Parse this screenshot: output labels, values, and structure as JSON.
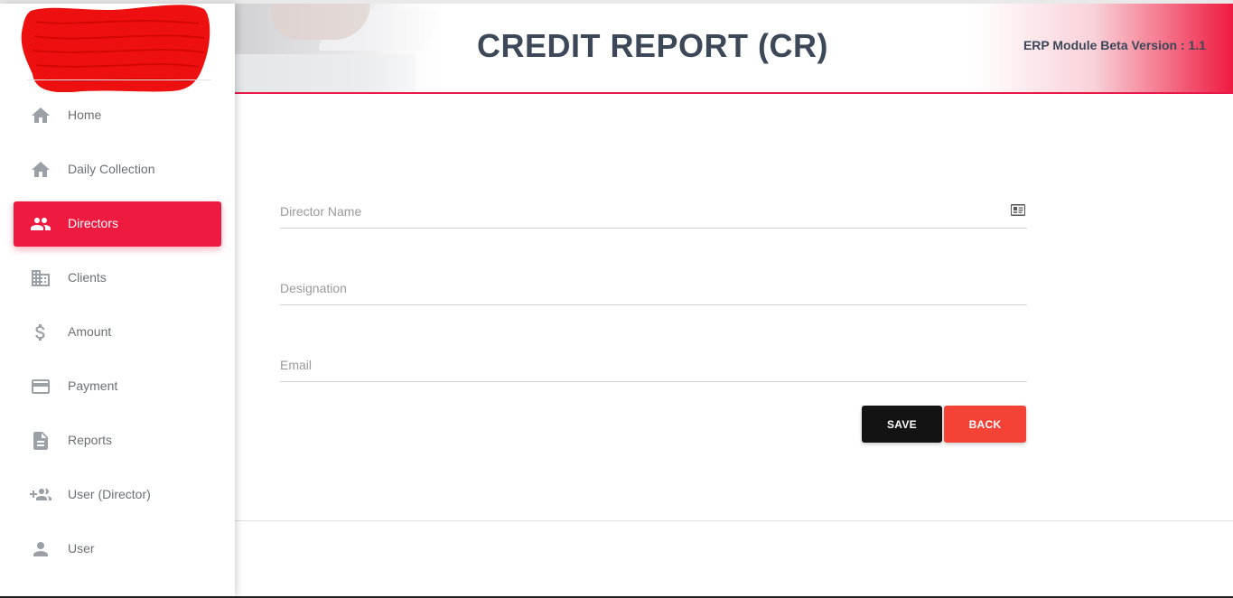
{
  "header": {
    "title": "CREDIT REPORT (CR)",
    "version": "ERP Module Beta Version : 1.1"
  },
  "sidebar": {
    "logo_icon": "redacted-logo",
    "items": [
      {
        "label": "Home",
        "icon": "home-icon",
        "active": false
      },
      {
        "label": "Daily Collection",
        "icon": "home-icon",
        "active": false
      },
      {
        "label": "Directors",
        "icon": "people-icon",
        "active": true
      },
      {
        "label": "Clients",
        "icon": "building-icon",
        "active": false
      },
      {
        "label": "Amount",
        "icon": "dollar-icon",
        "active": false
      },
      {
        "label": "Payment",
        "icon": "credit-card-icon",
        "active": false
      },
      {
        "label": "Reports",
        "icon": "document-icon",
        "active": false
      },
      {
        "label": "User (Director)",
        "icon": "add-group-icon",
        "active": false
      },
      {
        "label": "User",
        "icon": "person-icon",
        "active": false
      }
    ]
  },
  "form": {
    "director_name": {
      "placeholder": "Director Name",
      "value": ""
    },
    "designation": {
      "placeholder": "Designation",
      "value": ""
    },
    "email": {
      "placeholder": "Email",
      "value": ""
    },
    "save_label": "SAVE",
    "back_label": "BACK"
  },
  "colors": {
    "accent": "#ef1a40",
    "save_button": "#131313",
    "back_button": "#f44336",
    "title_text": "#3c4858"
  }
}
